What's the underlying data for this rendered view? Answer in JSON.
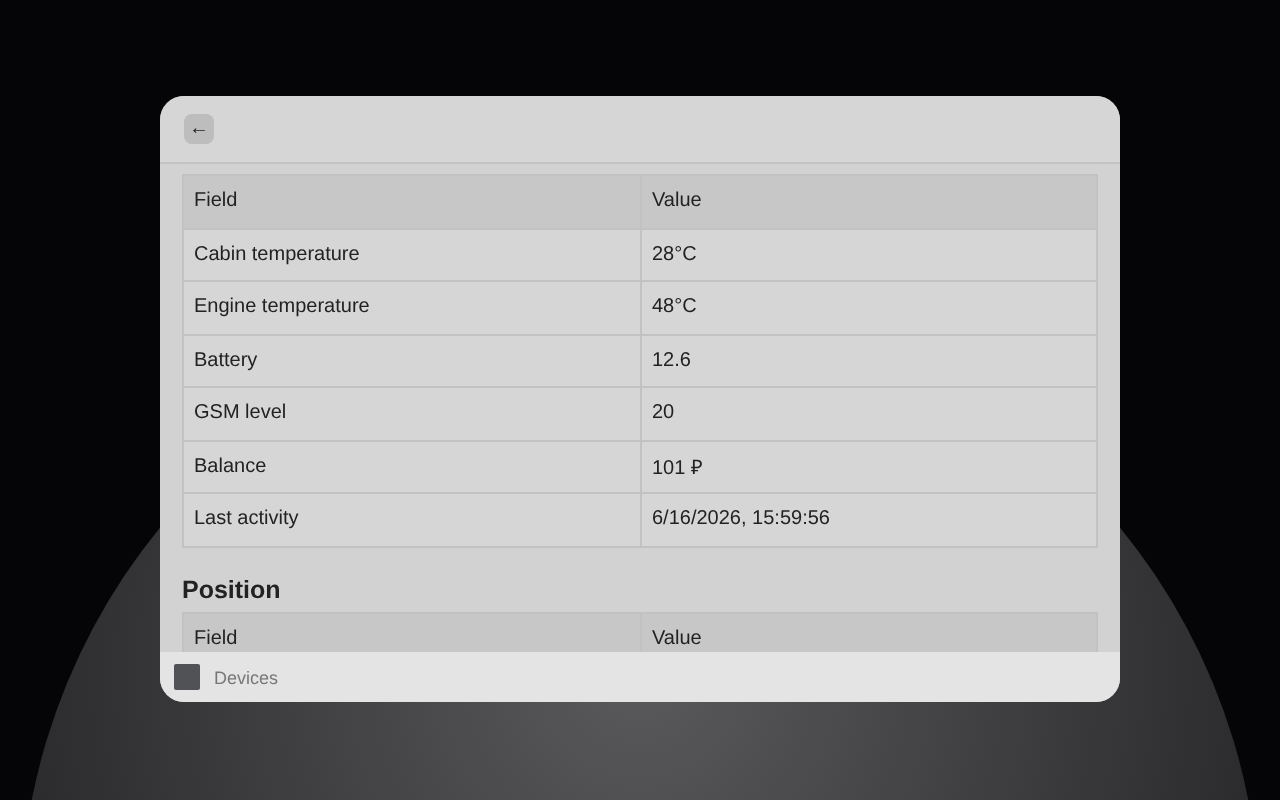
{
  "toolbar": {
    "back_button": "←"
  },
  "table": {
    "columns": [
      "Field",
      "Value"
    ],
    "rows": [
      [
        "Cabin temperature",
        "28°C"
      ],
      [
        "Engine temperature",
        "48°C"
      ],
      [
        "Battery",
        "12.6"
      ],
      [
        "GSM level",
        "20"
      ],
      [
        "Balance",
        "101 ₽"
      ],
      [
        "Last activity",
        "6/16/2026, 15:59:56"
      ]
    ]
  },
  "position": {
    "heading": "Position",
    "columns": [
      "Field",
      "Value"
    ]
  },
  "footer": {
    "label": "Devices"
  }
}
